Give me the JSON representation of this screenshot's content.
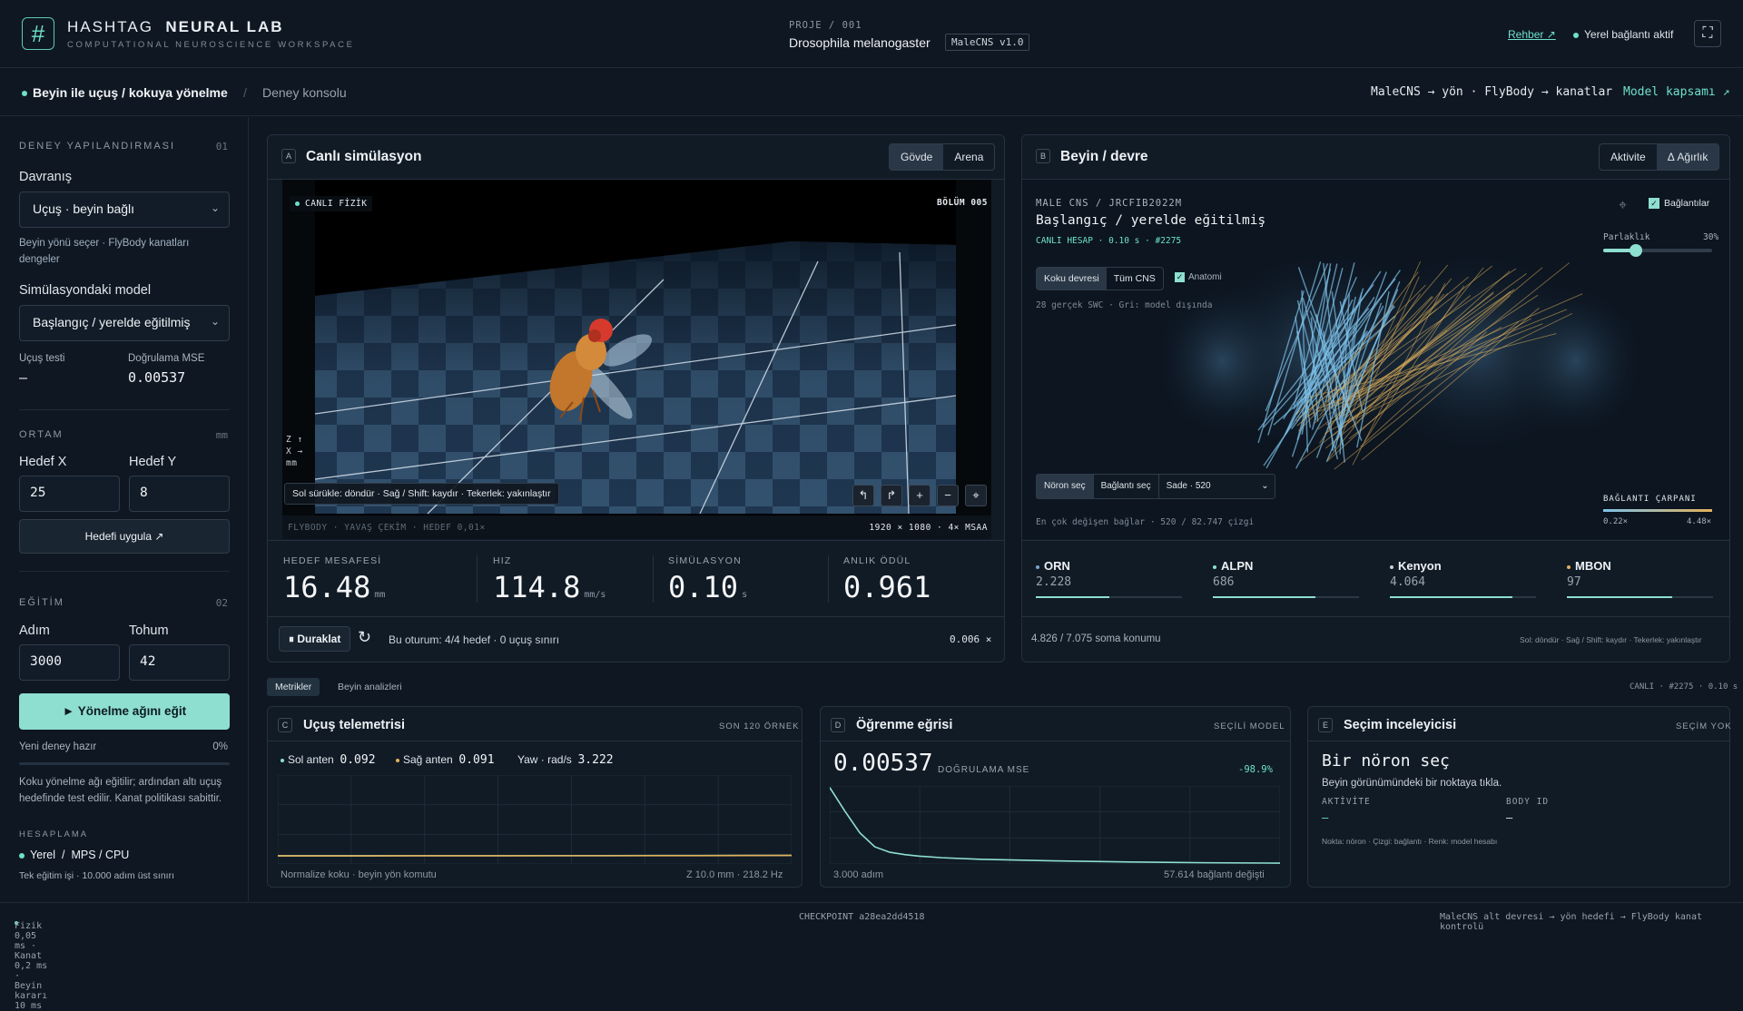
{
  "header": {
    "logo": "#",
    "brand_a": "HASHTAG",
    "brand_b": "NEURAL LAB",
    "brand_sub": "COMPUTATIONAL NEUROSCIENCE WORKSPACE",
    "project_label": "PROJE / 001",
    "project_name": "Drosophila melanogaster",
    "project_badge": "MaleCNS v1.0",
    "guide": "Rehber ↗",
    "connection": "Yerel bağlantı aktif"
  },
  "crumbs": {
    "current": "Beyin ile uçuş / kokuya yönelme",
    "sep": "/",
    "parent": "Deney konsolu",
    "pipeline": "MaleCNS → yön · FlyBody → kanatlar",
    "scope": "Model kapsamı ↗"
  },
  "sidebar": {
    "config_title": "DENEY YAPILANDIRMASI",
    "config_num": "01",
    "behavior_label": "Davranış",
    "behavior_value": "Uçuş · beyin bağlı",
    "behavior_note": "Beyin yönü seçer · FlyBody kanatları dengeler",
    "model_label": "Simülasyondaki model",
    "model_value": "Başlangıç / yerelde eğitilmiş",
    "flight_test_label": "Uçuş testi",
    "flight_test_value": "—",
    "mse_label": "Doğrulama MSE",
    "mse_value": "0.00537",
    "env_title": "ORTAM",
    "env_unit": "mm",
    "target_x_label": "Hedef X",
    "target_x": "25",
    "target_y_label": "Hedef Y",
    "target_y": "8",
    "apply_target": "Hedefi uygula ↗",
    "train_title": "EĞİTİM",
    "train_num": "02",
    "steps_label": "Adım",
    "steps": "3000",
    "seed_label": "Tohum",
    "seed": "42",
    "train_button": "►  Yönelme ağını eğit",
    "status": "Yeni deney hazır",
    "progress_text": "0%",
    "progress": 0,
    "train_note": "Koku yönelme ağı eğitilir; ardından altı uçuş hedefinde test edilir. Kanat politikası sabittir.",
    "compute_title": "HESAPLAMA",
    "compute_local": "Yerel",
    "compute_sep": "/",
    "compute_device": "MPS / CPU",
    "compute_note": "Tek eğitim işi · 10.000 adım üst sınırı"
  },
  "sim": {
    "tag": "A",
    "title": "Canlı simülasyon",
    "seg_body": "Gövde",
    "seg_arena": "Arena",
    "live": "CANLI FİZİK",
    "episode": "BÖLÜM 005",
    "axis": "Z ↑\nX →\nmm",
    "hint": "Sol sürükle: döndür · Sağ / Shift: kaydır · Tekerlek: yakınlaştır",
    "footer_left": "FLYBODY  ·  YAVAŞ ÇEKİM · HEDEF 0,01×",
    "footer_right": "1920 × 1080 · 4× MSAA",
    "stats": [
      {
        "label": "HEDEF MESAFESİ",
        "value": "16.48",
        "unit": "mm"
      },
      {
        "label": "HIZ",
        "value": "114.8",
        "unit": "mm/s"
      },
      {
        "label": "SİMÜLASYON",
        "value": "0.10",
        "unit": "s"
      },
      {
        "label": "ANLIK ÖDÜL",
        "value": "0.961",
        "unit": ""
      }
    ],
    "pause": "⏸ Duraklat",
    "session": "Bu oturum: 4/4 hedef · 0 uçuş sınırı",
    "speed": "0.006 ×"
  },
  "brain": {
    "tag": "B",
    "title": "Beyin / devre",
    "seg_activity": "Aktivite",
    "seg_weight": "Δ Ağırlık",
    "dataset": "MALE CNS / JRCFIB2022M",
    "state": "Başlangıç / yerelde eğitilmiş",
    "live_calc": "CANLI HESAP · 0.10 s · #2275",
    "seg_olf": "Koku devresi",
    "seg_all": "Tüm CNS",
    "anatomy": "Anatomi",
    "swc_note": "28 gerçek SWC · Gri: model dışında",
    "connections": "Bağlantılar",
    "brightness": "Parlaklık",
    "brightness_value": "30%",
    "brightness_level": 0.3,
    "pick_neuron": "Nöron seç",
    "pick_link": "Bağlantı seç",
    "simple": "Sade · 520",
    "multiplier": "BAĞLANTI ÇARPANI",
    "mult_min": "0.22×",
    "mult_max": "4.48×",
    "top_changed": "En çok değişen bağlar · 520 / 82.747 çizgi",
    "neurons": [
      {
        "name": "ORN",
        "count": "2.228",
        "color": "#7ea4c9",
        "fill": 0.5
      },
      {
        "name": "ALPN",
        "count": "686",
        "color": "#8edfd0",
        "fill": 0.7
      },
      {
        "name": "Kenyon",
        "count": "4.064",
        "color": "#c9d1d9",
        "fill": 0.84
      },
      {
        "name": "MBON",
        "count": "97",
        "color": "#e2b15a",
        "fill": 0.72
      }
    ],
    "soma": "4.826 / 7.075 soma konumu",
    "hint": "Sol: döndür · Sağ / Shift: kaydır · Tekerlek: yakınlaştır"
  },
  "tabs": {
    "metrics": "Metrikler",
    "analysis": "Beyin analizleri",
    "live": "CANLI · #2275 · 0.10 s"
  },
  "telemetry": {
    "tag": "C",
    "title": "Uçuş telemetrisi",
    "window": "SON 120 ÖRNEK",
    "left_label": "Sol anten",
    "left_value": "0.092",
    "right_label": "Sağ anten",
    "right_value": "0.091",
    "yaw_label": "Yaw · rad/s",
    "yaw_value": "3.222",
    "foot_left": "Normalize koku · beyin yön komutu",
    "foot_right": "Z 10.0 mm · 218.2 Hz"
  },
  "learning": {
    "tag": "D",
    "title": "Öğrenme eğrisi",
    "scope": "SEÇİLİ MODEL",
    "value": "0.00537",
    "value_label": "DOĞRULAMA MSE",
    "delta": "-98.9%",
    "foot_left": "3.000 adım",
    "foot_right": "57.614 bağlantı değişti"
  },
  "inspector": {
    "tag": "E",
    "title": "Seçim inceleyicisi",
    "state": "SEÇİM YOK",
    "heading": "Bir nöron seç",
    "sub": "Beyin görünümündeki bir noktaya tıkla.",
    "activity_label": "AKTİVİTE",
    "activity_value": "—",
    "body_label": "BODY ID",
    "body_value": "—",
    "legend": "Nokta: nöron · Çizgi: bağlantı · Renk: model hesabı"
  },
  "footer": {
    "timing": "Fizik 0,05 ms · Kanat 0,2 ms · Beyin kararı 10 ms",
    "checkpoint": "CHECKPOINT a28ea2dd4518",
    "flow": "MaleCNS alt devresi → yön hedefi → FlyBody kanat kontrolü"
  },
  "colors": {
    "accent": "#8edfd0",
    "bg": "#0f1722",
    "panel": "#111b26",
    "warm": "#e2b15a",
    "cool": "#7ec2ea"
  },
  "chart_data": [
    {
      "type": "line",
      "title": "Uçuş telemetrisi",
      "series": [
        {
          "name": "Sol anten",
          "values": [
            0.092,
            0.092,
            0.092,
            0.093,
            0.093,
            0.093,
            0.094,
            0.094,
            0.095,
            0.095,
            0.096,
            0.097
          ]
        },
        {
          "name": "Sağ anten",
          "values": [
            0.091,
            0.091,
            0.091,
            0.092,
            0.092,
            0.092,
            0.093,
            0.093,
            0.094,
            0.094,
            0.095,
            0.096
          ]
        }
      ],
      "ylim": [
        0,
        1
      ]
    },
    {
      "type": "line",
      "title": "Öğrenme eğrisi",
      "x": [
        0,
        100,
        200,
        300,
        400,
        500,
        600,
        750,
        1000,
        1500,
        2000,
        2500,
        3000
      ],
      "values": [
        0.49,
        0.34,
        0.2,
        0.11,
        0.075,
        0.06,
        0.05,
        0.04,
        0.03,
        0.02,
        0.013,
        0.008,
        0.00537
      ],
      "ylim": [
        0,
        0.5
      ]
    }
  ]
}
